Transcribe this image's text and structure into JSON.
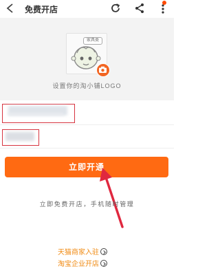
{
  "header": {
    "title": "免费开店"
  },
  "logo": {
    "avatar_tag": "家具类",
    "caption": "设置你的淘小铺LOGO"
  },
  "form": {
    "primary_button": "立即开通"
  },
  "tagline": "立即免费开店，手机随时管理",
  "links": [
    {
      "label": "天猫商家入驻"
    },
    {
      "label": "淘宝企业开店"
    }
  ],
  "colors": {
    "accent": "#ff6a12",
    "highlight_border": "#d6333f",
    "arrow": "#e0283f",
    "link": "#f08a12"
  }
}
